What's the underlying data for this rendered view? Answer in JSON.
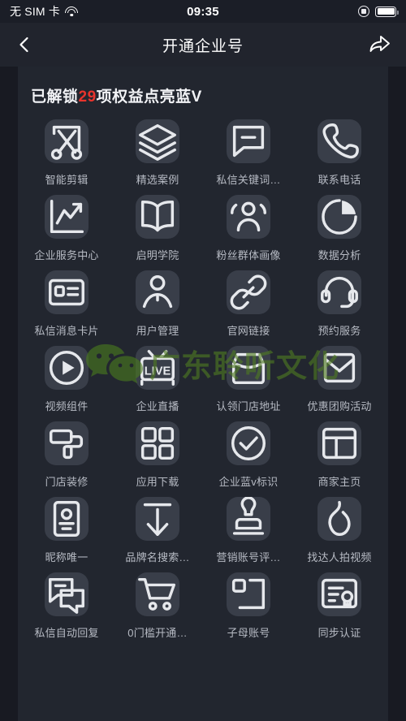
{
  "status_bar": {
    "carrier": "无 SIM 卡",
    "wifi_icon": "wifi-icon",
    "time": "09:35",
    "rotation_lock_icon": "rotation-lock-icon",
    "battery_icon": "battery-full-icon"
  },
  "nav_bar": {
    "back_icon": "back-chevron-icon",
    "title": "开通企业号",
    "share_icon": "share-arrow-icon"
  },
  "headline": {
    "prefix": "已解锁",
    "count": "29",
    "suffix": "项权益点亮蓝V",
    "count_color": "#e8342c"
  },
  "watermark": {
    "logo_icon": "wechat-logo-icon",
    "text": "广东聆听文化",
    "color": "#4f7a21"
  },
  "theme": {
    "page_bg": "#22262f",
    "gutter_bg": "#181a22",
    "tile_bg": "#393e49",
    "icon_color": "#e6e8ec",
    "label_color": "#b7bbc4",
    "nav_bg": "#21242d"
  },
  "grid": {
    "items": [
      {
        "label": "智能剪辑",
        "icon": "scissors-crop-icon"
      },
      {
        "label": "精选案例",
        "icon": "layers-icon"
      },
      {
        "label": "私信关键词…",
        "icon": "message-bubble-icon"
      },
      {
        "label": "联系电话",
        "icon": "phone-icon"
      },
      {
        "label": "企业服务中心",
        "icon": "line-chart-icon"
      },
      {
        "label": "启明学院",
        "icon": "open-book-icon"
      },
      {
        "label": "粉丝群体画像",
        "icon": "people-group-icon"
      },
      {
        "label": "数据分析",
        "icon": "pie-chart-icon"
      },
      {
        "label": "私信消息卡片",
        "icon": "contact-card-icon"
      },
      {
        "label": "用户管理",
        "icon": "user-person-icon"
      },
      {
        "label": "官网链接",
        "icon": "link-chain-icon"
      },
      {
        "label": "预约服务",
        "icon": "headset-icon"
      },
      {
        "label": "视频组件",
        "icon": "play-circle-icon"
      },
      {
        "label": "企业直播",
        "icon": "live-tv-icon"
      },
      {
        "label": "认领门店地址",
        "icon": "storefront-icon"
      },
      {
        "label": "优惠团购活动",
        "icon": "envelope-icon"
      },
      {
        "label": "门店装修",
        "icon": "paint-roller-icon"
      },
      {
        "label": "应用下载",
        "icon": "grid-squares-icon"
      },
      {
        "label": "企业蓝v标识",
        "icon": "check-circle-icon"
      },
      {
        "label": "商家主页",
        "icon": "layout-page-icon"
      },
      {
        "label": "昵称唯一",
        "icon": "id-card-icon"
      },
      {
        "label": "品牌名搜索…",
        "icon": "arrow-up-icon"
      },
      {
        "label": "营销账号评…",
        "icon": "stamp-icon"
      },
      {
        "label": "找达人拍视频",
        "icon": "flame-icon"
      },
      {
        "label": "私信自动回复",
        "icon": "chat-reply-icon"
      },
      {
        "label": "0门槛开通…",
        "icon": "shopping-cart-icon"
      },
      {
        "label": "子母账号",
        "icon": "parent-child-account-icon"
      },
      {
        "label": "同步认证",
        "icon": "certificate-icon"
      }
    ]
  }
}
